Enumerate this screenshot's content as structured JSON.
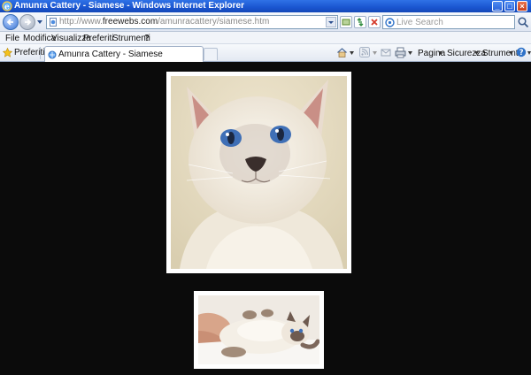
{
  "window": {
    "title": "Amunra Cattery - Siamese - Windows Internet Explorer",
    "min_glyph": "_",
    "max_glyph": "□",
    "close_glyph": "×"
  },
  "address": {
    "url_prefix": "http://www.",
    "url_domain": "freewebs.com",
    "url_path": "/amunracattery/siamese.htm"
  },
  "search": {
    "placeholder": "Live Search"
  },
  "menu": {
    "items": [
      "File",
      "Modifica",
      "Visualizza",
      "Preferiti",
      "Strumenti",
      "?"
    ]
  },
  "favorites": {
    "label": "Preferiti",
    "tab_title": "Amunra Cattery - Siamese"
  },
  "command_bar": {
    "page": "Pagina",
    "safety": "Sicurezza",
    "tools": "Strumenti"
  },
  "colors": {
    "titlebar": "#2f72e6",
    "page_background": "#0b0b0b",
    "photo_border": "#ffffff"
  },
  "content": {
    "photos": [
      {
        "name": "siamese-cat-portrait"
      },
      {
        "name": "siamese-cat-lying"
      }
    ]
  }
}
